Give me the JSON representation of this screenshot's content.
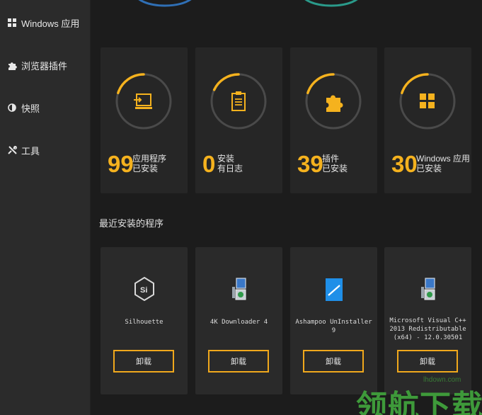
{
  "sidebar": {
    "items": [
      {
        "label": "Windows 应用",
        "icon": "windows-grid-icon"
      },
      {
        "label": "浏览器插件",
        "icon": "puzzle-icon"
      },
      {
        "label": "快照",
        "icon": "snapshot-icon"
      },
      {
        "label": "工具",
        "icon": "tools-icon"
      }
    ]
  },
  "stats": [
    {
      "number": "99",
      "line1": "应用程序",
      "line2": "已安装",
      "icon": "laptop-install-icon",
      "progress": 0.2
    },
    {
      "number": "0",
      "line1": "安装",
      "line2": "有日志",
      "icon": "clipboard-icon",
      "progress": 0.18
    },
    {
      "number": "39",
      "line1": "插件",
      "line2": "已安装",
      "icon": "puzzle-icon",
      "progress": 0.2
    },
    {
      "number": "30",
      "line1": "Windows 应用",
      "line2": "已安装",
      "icon": "windows-grid-icon",
      "progress": 0.2
    }
  ],
  "recent": {
    "title": "最近安装的程序",
    "apps": [
      {
        "name": "Silhouette",
        "button": "卸载",
        "icon": "silhouette-app-icon"
      },
      {
        "name": "4K Downloader 4",
        "button": "卸载",
        "icon": "installer-package-icon"
      },
      {
        "name": "Ashampoo UnInstaller 9",
        "button": "卸载",
        "icon": "ashampoo-app-icon"
      },
      {
        "name": "Microsoft Visual C++ 2013 Redistributable (x64) - 12.0.30501",
        "button": "卸载",
        "icon": "installer-package-icon"
      }
    ]
  },
  "colors": {
    "accent": "#f5b21e",
    "sidebar": "#2b2b2b",
    "card": "#262626",
    "background": "#1c1c1c"
  },
  "watermark": {
    "text": "领航下载",
    "url": "lhdown.com"
  }
}
